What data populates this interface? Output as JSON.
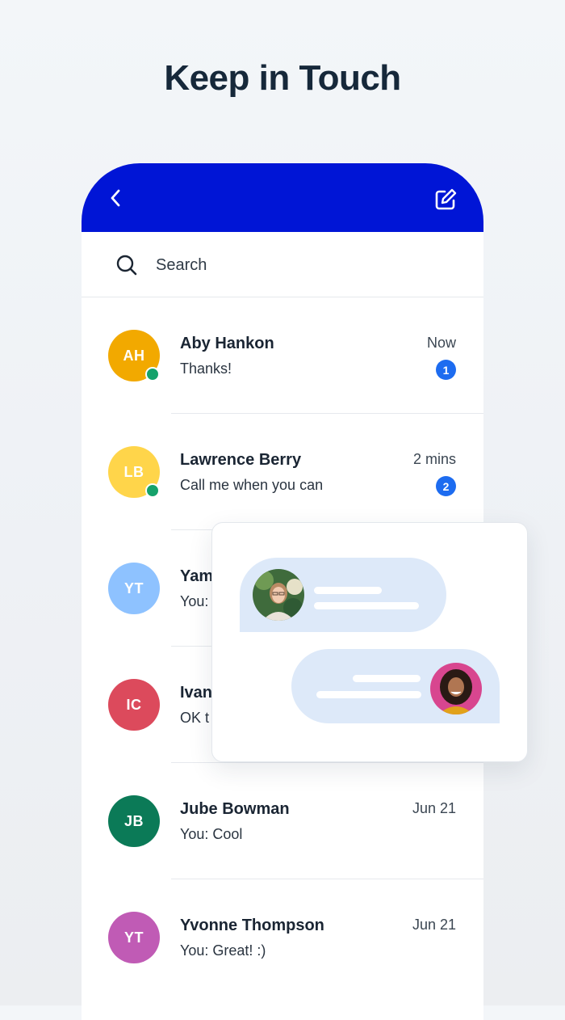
{
  "headline": "Keep in Touch",
  "colors": {
    "header": "#0015d6",
    "badge": "#1d6cf0",
    "online": "#15a26b"
  },
  "header": {
    "back_icon": "chevron-left-icon",
    "compose_icon": "compose-edit-icon"
  },
  "search": {
    "placeholder": "Search",
    "icon": "search-icon"
  },
  "conversations": [
    {
      "initials": "AH",
      "color": "#f2a900",
      "name": "Aby Hankon",
      "preview": "Thanks!",
      "time": "Now",
      "unread": "1",
      "online": true
    },
    {
      "initials": "LB",
      "color": "#ffd54a",
      "name": "Lawrence Berry",
      "preview": "Call me when you can",
      "time": "2 mins",
      "unread": "2",
      "online": true
    },
    {
      "initials": "YT",
      "color": "#8ec2ff",
      "name": "Yam",
      "preview": "You:",
      "time": "",
      "unread": "",
      "online": false
    },
    {
      "initials": "IC",
      "color": "#dc4a5c",
      "name": "Ivan",
      "preview": "OK t",
      "time": "",
      "unread": "",
      "online": false
    },
    {
      "initials": "JB",
      "color": "#0b7a57",
      "name": "Jube Bowman",
      "preview": "You: Cool",
      "time": "Jun 21",
      "unread": "",
      "online": false
    },
    {
      "initials": "YT",
      "color": "#c05bb5",
      "name": "Yvonne Thompson",
      "preview": "You: Great! :)",
      "time": "Jun 21",
      "unread": "",
      "online": false
    }
  ]
}
